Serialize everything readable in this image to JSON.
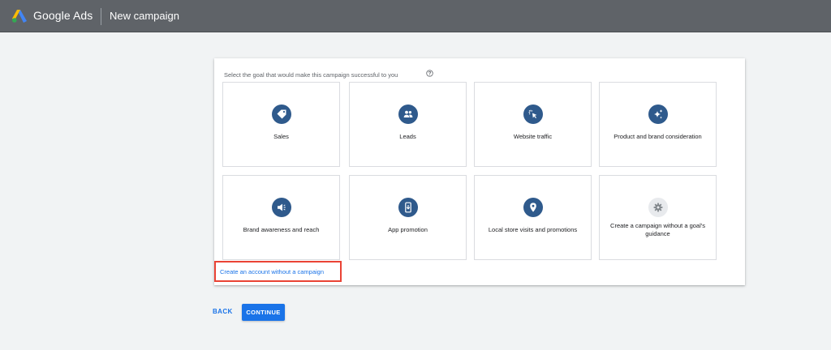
{
  "header": {
    "app_name": "Google Ads",
    "page_title": "New campaign",
    "background": "#5f6368"
  },
  "goal_section": {
    "prompt": "Select the goal that would make this campaign successful to you",
    "help_icon": "help-circle-icon",
    "goals": [
      {
        "label": "Sales",
        "icon": "tag-icon"
      },
      {
        "label": "Leads",
        "icon": "people-icon"
      },
      {
        "label": "Website traffic",
        "icon": "cursor-click-icon"
      },
      {
        "label": "Product and brand consideration",
        "icon": "sparkle-icon"
      },
      {
        "label": "Brand awareness and reach",
        "icon": "megaphone-icon"
      },
      {
        "label": "App promotion",
        "icon": "phone-download-icon"
      },
      {
        "label": "Local store visits and promotions",
        "icon": "location-pin-icon"
      },
      {
        "label": "Create a campaign without a goal's guidance",
        "icon": "gear-icon"
      }
    ],
    "create_account_link": "Create an account without a campaign",
    "highlight_color": "#ea4335"
  },
  "actions": {
    "back_label": "BACK",
    "continue_label": "CONTINUE",
    "accent": "#1a73e8"
  }
}
